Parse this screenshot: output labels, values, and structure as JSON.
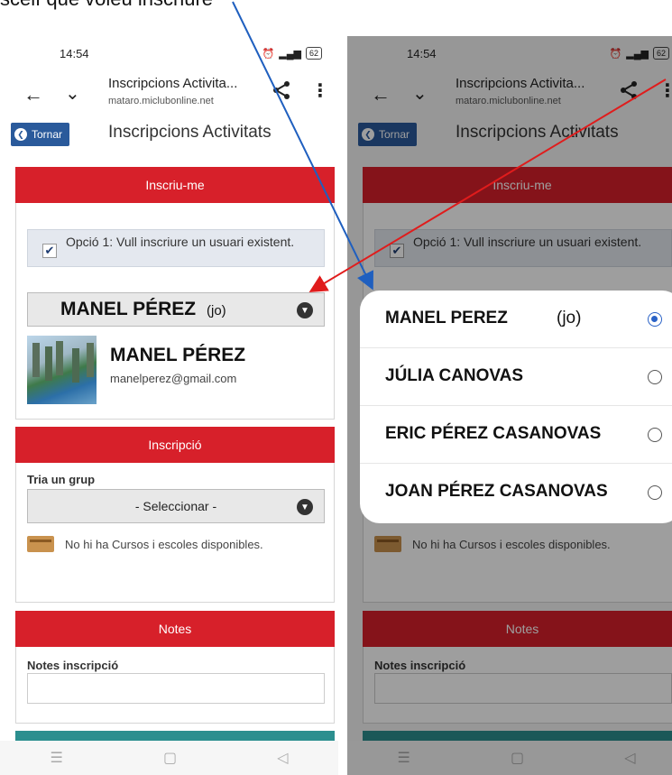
{
  "caption": "sceif que voleu inscriure",
  "status": {
    "time": "14:54",
    "battery": "62"
  },
  "browser": {
    "title": "Inscripcions Activita...",
    "url": "mataro.miclubonline.net"
  },
  "app": {
    "back_label": "Tornar",
    "title": "Inscripcions Activitats"
  },
  "inscriu": {
    "header": "Inscriu-me",
    "option_text": "Opció 1: Vull inscriure un usuari existent.",
    "selected_name": "MANEL PÉREZ",
    "selected_tag": "(jo)",
    "user_name": "MANEL PÉREZ",
    "user_email": "manelperez@gmail.com"
  },
  "inscripcio": {
    "header": "Inscripció",
    "group_label": "Tria un grup",
    "group_placeholder": "- Seleccionar -",
    "empty_message": "No hi ha Cursos i escoles disponibles."
  },
  "notes": {
    "header": "Notes",
    "label": "Notes inscripció"
  },
  "dialog": {
    "options": [
      {
        "name": "MANEL PEREZ",
        "tag": "(jo)",
        "selected": true
      },
      {
        "name": "JÚLIA CANOVAS",
        "tag": "",
        "selected": false
      },
      {
        "name": "ERIC PÉREZ CASANOVAS",
        "tag": "",
        "selected": false
      },
      {
        "name": "JOAN PÉREZ CASANOVAS",
        "tag": "",
        "selected": false
      }
    ]
  },
  "colors": {
    "card_header_red": "#d7202a",
    "tornar_blue": "#2a5a9b",
    "radio_blue": "#2a62c7",
    "arrow_blue": "#1f5fbf",
    "arrow_red": "#e01c1c"
  }
}
